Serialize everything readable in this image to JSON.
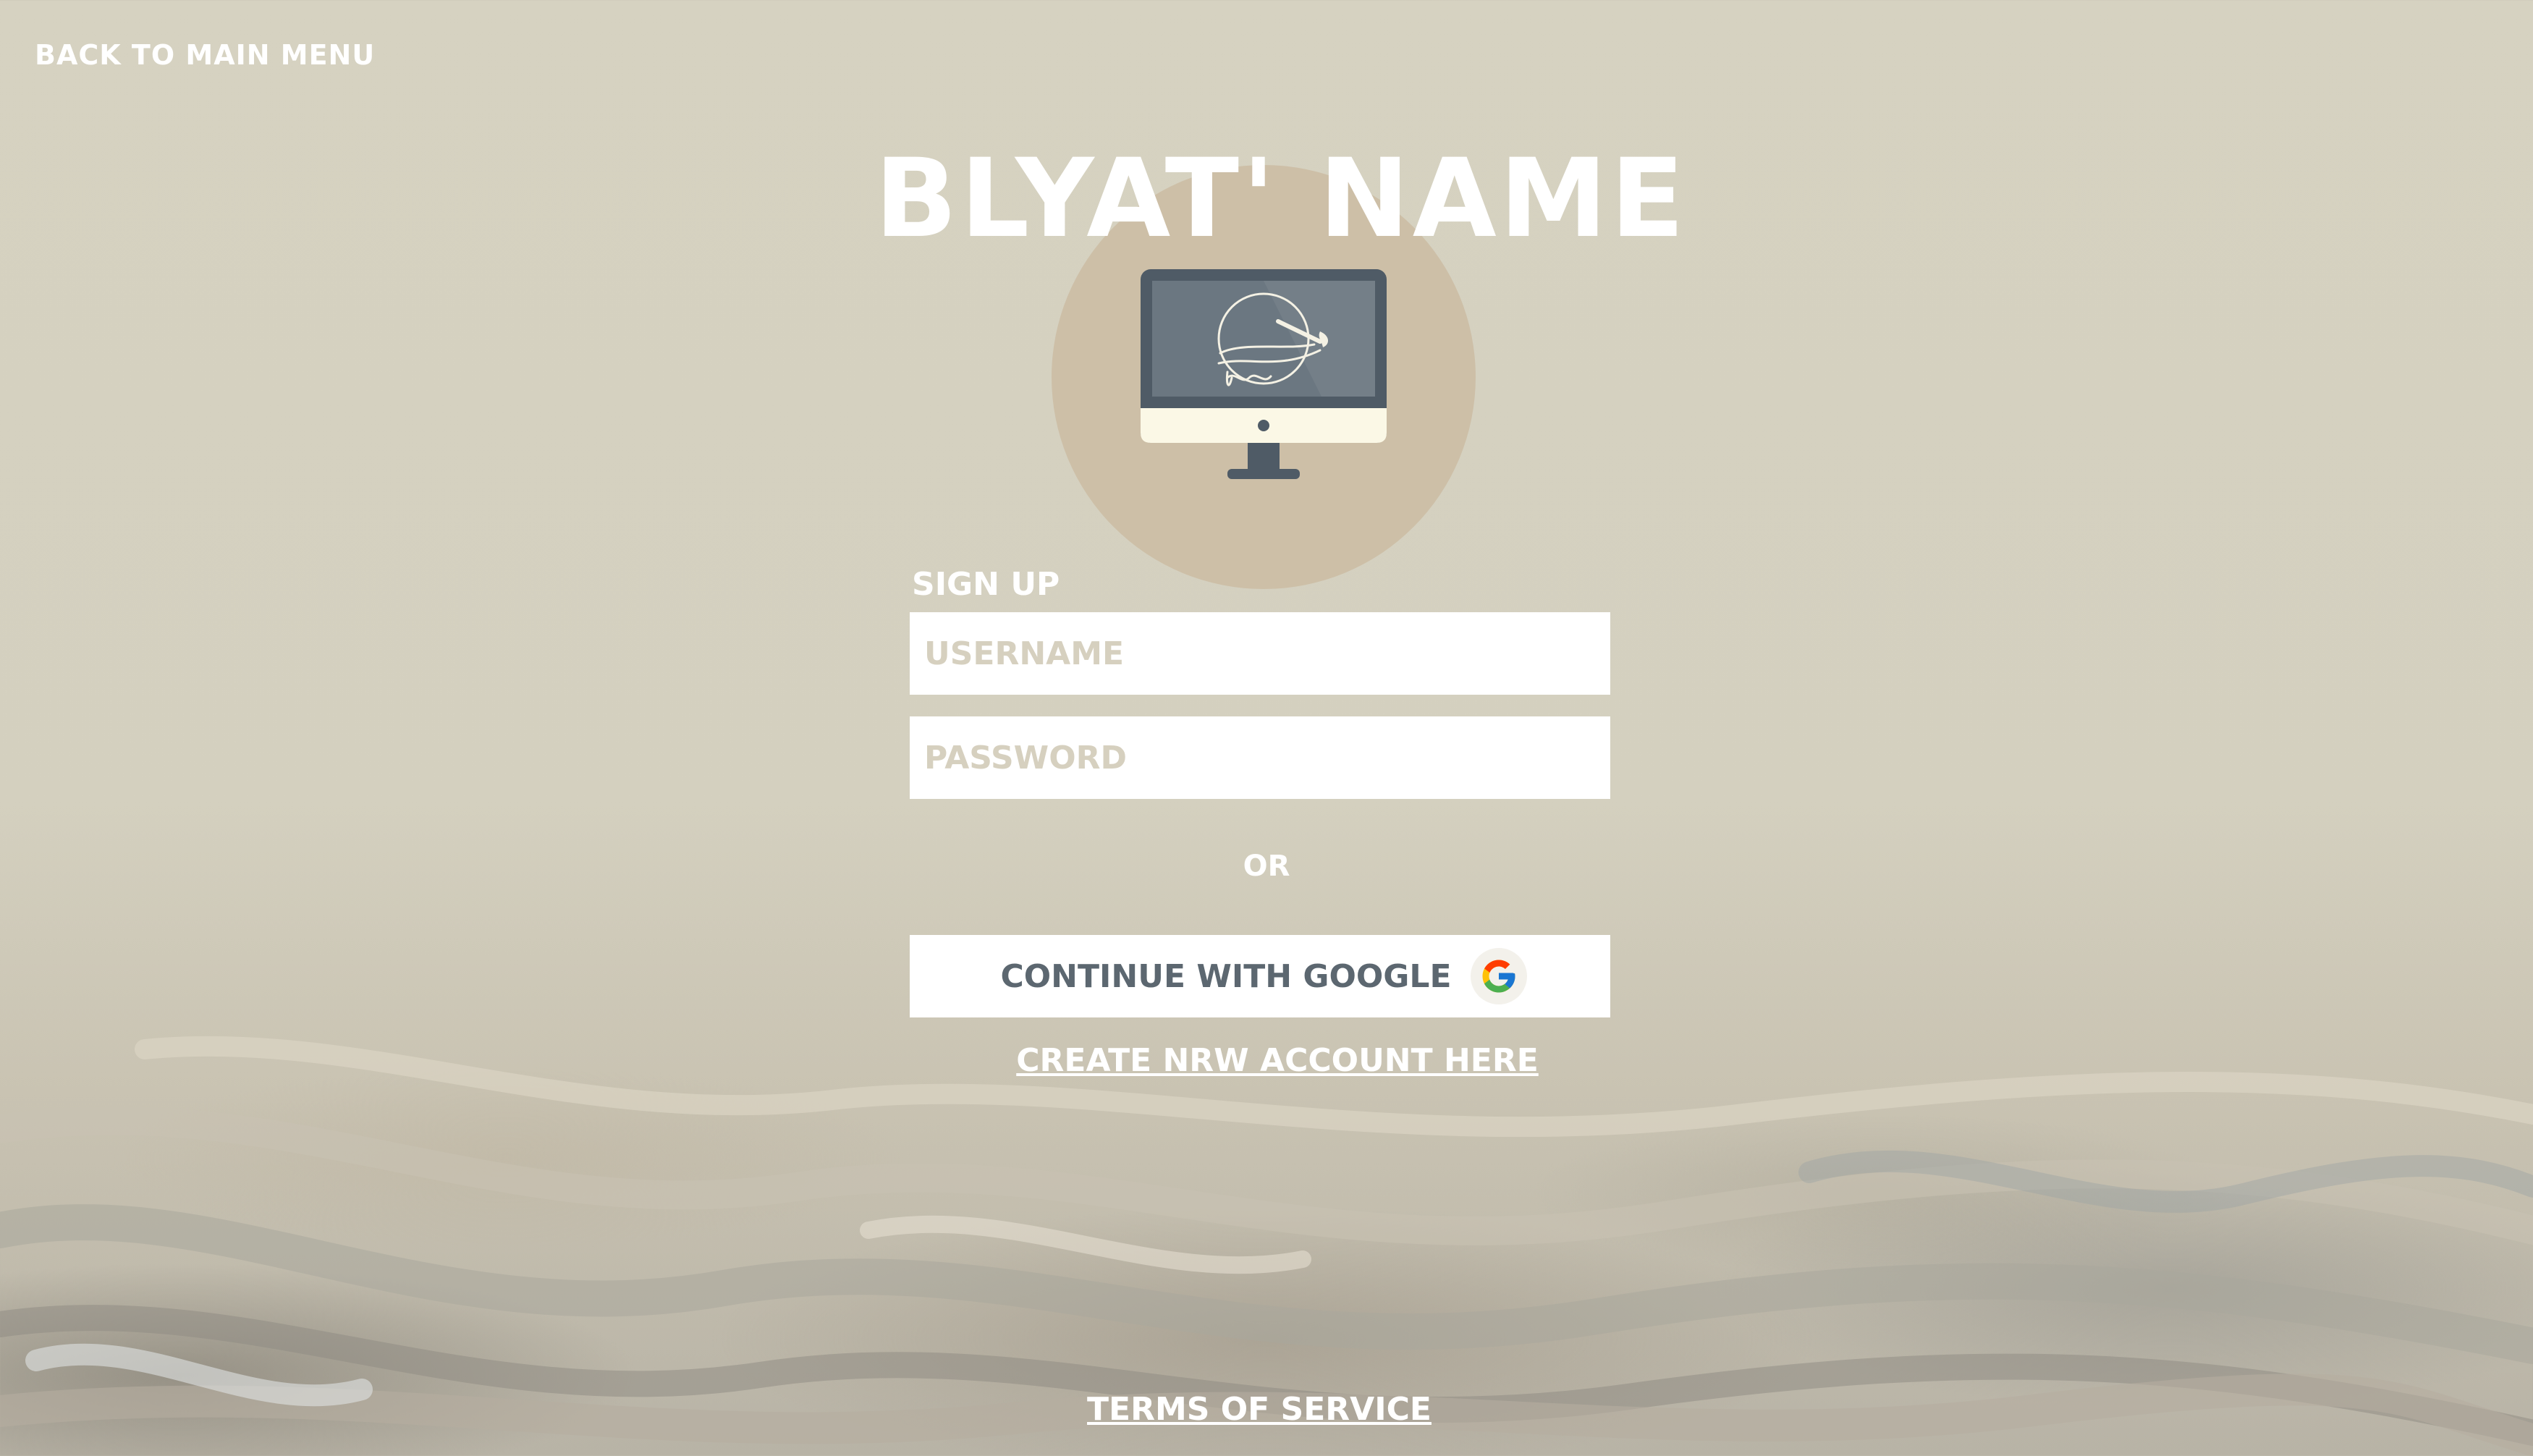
{
  "nav": {
    "back_label": "BACK TO MAIN MENU"
  },
  "header": {
    "title": "BLYAT' NAME"
  },
  "logo": {
    "icon": "computer-monitor-signature-icon"
  },
  "form": {
    "heading": "SIGN UP",
    "username_placeholder": "USERNAME",
    "password_placeholder": "PASSWORD",
    "or_label": "OR",
    "google_label": "CONTINUE WITH GOOGLE",
    "google_icon": "google-g-icon",
    "create_account_label": "CREATE NRW ACCOUNT HERE"
  },
  "footer": {
    "terms_label": "TERMS OF SERVICE"
  },
  "colors": {
    "background": "#d6d2c1",
    "logo_circle": "#cdbfa7",
    "monitor_frame": "#4f5b66",
    "monitor_screen": "#6b7781",
    "monitor_chin": "#fbf8e6",
    "button_text": "#5c6770",
    "placeholder_text": "#d6d0bf"
  }
}
